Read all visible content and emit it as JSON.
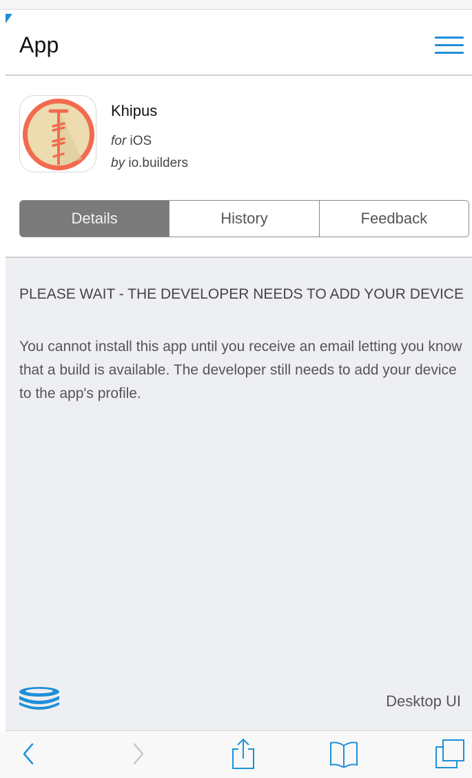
{
  "header": {
    "title": "App",
    "menu_icon": "hamburger-menu-icon"
  },
  "app": {
    "name": "Khipus",
    "platform_prefix": "for",
    "platform": "iOS",
    "developer_prefix": "by",
    "developer": "io.builders",
    "icon": "khipus-app-icon"
  },
  "tabs": {
    "details": "Details",
    "history": "History",
    "feedback": "Feedback",
    "active": "Details"
  },
  "notice": {
    "title": "PLEASE WAIT - THE DEVELOPER NEEDS TO ADD YOUR DEVICE",
    "body": "You cannot install this app until you receive an email letting you know that a build is available. The developer still needs to add your device to the app's profile."
  },
  "footer": {
    "desktop_link": "Desktop UI",
    "logo_icon": "stacked-disks-logo-icon"
  },
  "toolbar": {
    "back_icon": "back-chevron-icon",
    "forward_icon": "forward-chevron-icon",
    "share_icon": "share-icon",
    "bookmarks_icon": "bookmarks-book-icon",
    "tabs_icon": "tabs-icon"
  },
  "colors": {
    "accent": "#1f8fd8",
    "tab_active_bg": "#7a7a7a",
    "content_bg": "#eeeff2",
    "icon_ring": "#f26b4f",
    "icon_fill": "#ecdcb0"
  }
}
